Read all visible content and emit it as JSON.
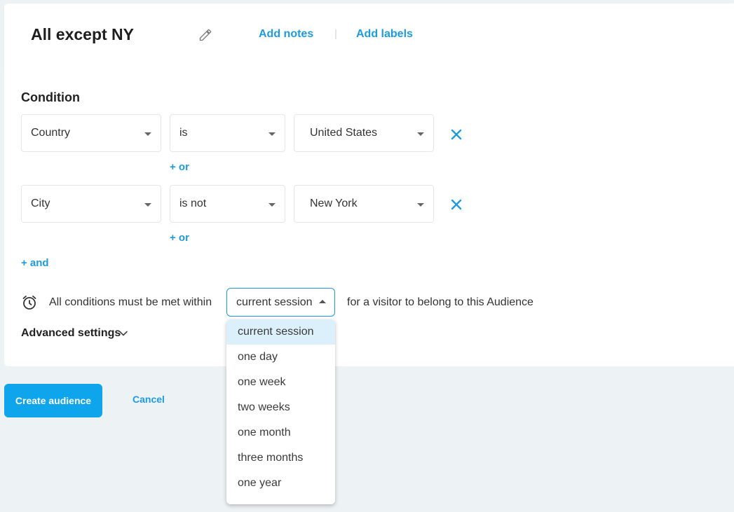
{
  "header": {
    "title": "All except NY",
    "add_notes": "Add notes",
    "separator": "|",
    "add_labels": "Add labels"
  },
  "condition": {
    "title": "Condition",
    "rows": [
      {
        "field": "Country",
        "operator": "is",
        "value": "United States",
        "or_label": "+ or"
      },
      {
        "field": "City",
        "operator": "is not",
        "value": "New York",
        "or_label": "+ or"
      }
    ],
    "and_label": "+ and"
  },
  "timeframe": {
    "prefix": "All conditions must be met within",
    "selected": "current session",
    "suffix": "for a visitor to belong to this Audience",
    "options": [
      "current session",
      "one day",
      "one week",
      "two weeks",
      "one month",
      "three months",
      "one year"
    ]
  },
  "advanced": {
    "label": "Advanced settings"
  },
  "actions": {
    "create": "Create audience",
    "cancel": "Cancel"
  },
  "colors": {
    "accent": "#1e9be0",
    "button": "#0ea5ec",
    "selected_option_bg": "#dcf0fb",
    "page_bg": "#edf2f5"
  },
  "icons": {
    "edit": "pencil-icon",
    "remove": "close-icon",
    "time": "alarm-clock-icon",
    "expand": "chevron-down-icon"
  }
}
